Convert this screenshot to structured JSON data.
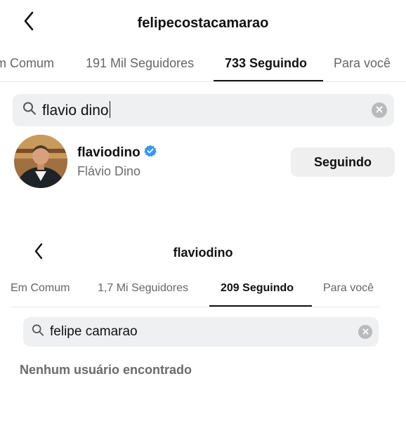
{
  "top": {
    "title": "felipecostacamarao",
    "tabs": [
      {
        "label": "m Comum",
        "active": false
      },
      {
        "label": "191 Mil Seguidores",
        "active": false
      },
      {
        "label": "733 Seguindo",
        "active": true
      },
      {
        "label": "Para você",
        "active": false
      }
    ],
    "search": {
      "query": "flavio dino"
    },
    "result": {
      "username": "flaviodino",
      "verified": true,
      "full_name": "Flávio Dino",
      "button_label": "Seguindo"
    }
  },
  "bottom": {
    "title": "flaviodino",
    "tabs": [
      {
        "label": "Em Comum",
        "active": false
      },
      {
        "label": "1,7 Mi Seguidores",
        "active": false
      },
      {
        "label": "209 Seguindo",
        "active": true
      },
      {
        "label": "Para você",
        "active": false
      }
    ],
    "search": {
      "query": "felipe camarao"
    },
    "empty_message": "Nenhum usuário encontrado"
  },
  "icons": {
    "back": "chevron-left-icon",
    "search": "magnifier-icon",
    "clear": "clear-x-icon",
    "verified": "verified-badge-icon"
  },
  "colors": {
    "verified_blue": "#3797f0",
    "search_bg": "#eff0f2",
    "button_bg": "#efefef",
    "muted_text": "#6b6b6b"
  }
}
